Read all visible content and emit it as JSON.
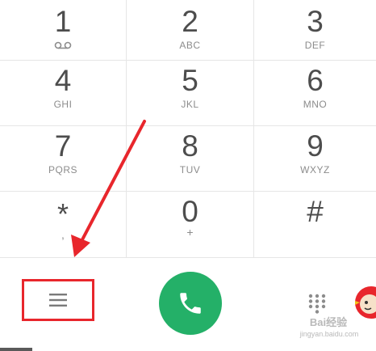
{
  "keypad": {
    "keys": [
      {
        "digit": "1",
        "letters": "",
        "icon": "voicemail-icon"
      },
      {
        "digit": "2",
        "letters": "ABC"
      },
      {
        "digit": "3",
        "letters": "DEF"
      },
      {
        "digit": "4",
        "letters": "GHI"
      },
      {
        "digit": "5",
        "letters": "JKL"
      },
      {
        "digit": "6",
        "letters": "MNO"
      },
      {
        "digit": "7",
        "letters": "PQRS"
      },
      {
        "digit": "8",
        "letters": "TUV"
      },
      {
        "digit": "9",
        "letters": "WXYZ"
      },
      {
        "digit": "*",
        "letters": ","
      },
      {
        "digit": "0",
        "letters": "+"
      },
      {
        "digit": "#",
        "letters": ""
      }
    ]
  },
  "bottom_bar": {
    "menu_icon": "menu-icon",
    "call_icon": "phone-icon",
    "dialpad_icon": "dialpad-icon",
    "call_color": "#24b068",
    "highlight_color": "#e8262c"
  },
  "watermark": {
    "text": "Bai经验",
    "url": "jingyan.baidu.com"
  }
}
